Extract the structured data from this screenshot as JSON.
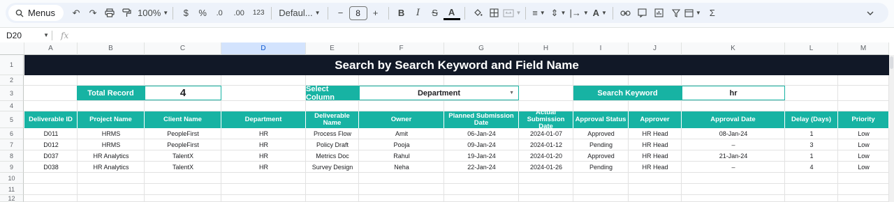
{
  "toolbar": {
    "menus_label": "Menus",
    "zoom": "100%",
    "currency": "$",
    "percent": "%",
    "dec_decrease": ".0",
    "dec_increase": ".00",
    "number_format": "123",
    "font": "Defaul...",
    "font_size": "8",
    "minus": "−",
    "plus": "+",
    "bold": "B",
    "italic": "I",
    "sum": "Σ"
  },
  "formula_bar": {
    "cell_ref": "D20",
    "fx": "fx",
    "value": ""
  },
  "columns": [
    "A",
    "B",
    "C",
    "D",
    "E",
    "F",
    "G",
    "H",
    "I",
    "J",
    "K",
    "L",
    "M"
  ],
  "rows": [
    "1",
    "2",
    "3",
    "4",
    "5",
    "6",
    "7",
    "8",
    "9",
    "10",
    "11",
    "12"
  ],
  "sheet": {
    "title": "Search by Search Keyword and Field Name",
    "total_record_label": "Total Record",
    "total_record_value": "4",
    "select_column_label": "Select Column",
    "select_column_value": "Department",
    "search_keyword_label": "Search Keyword",
    "search_keyword_value": "hr"
  },
  "table": {
    "headers": [
      "Deliverable ID",
      "Project Name",
      "Client Name",
      "Department",
      "Deliverable Name",
      "Owner",
      "Planned Submission Date",
      "Actual Submission Date",
      "Approval Status",
      "Approver",
      "Approval Date",
      "Delay (Days)",
      "Priority"
    ],
    "rows": [
      [
        "D011",
        "HRMS",
        "PeopleFirst",
        "HR",
        "Process Flow",
        "Amit",
        "06-Jan-24",
        "2024-01-07",
        "Approved",
        "HR Head",
        "08-Jan-24",
        "1",
        "Low"
      ],
      [
        "D012",
        "HRMS",
        "PeopleFirst",
        "HR",
        "Policy Draft",
        "Pooja",
        "09-Jan-24",
        "2024-01-12",
        "Pending",
        "HR Head",
        "–",
        "3",
        "Low"
      ],
      [
        "D037",
        "HR Analytics",
        "TalentX",
        "HR",
        "Metrics Doc",
        "Rahul",
        "19-Jan-24",
        "2024-01-20",
        "Approved",
        "HR Head",
        "21-Jan-24",
        "1",
        "Low"
      ],
      [
        "D038",
        "HR Analytics",
        "TalentX",
        "HR",
        "Survey Design",
        "Neha",
        "22-Jan-24",
        "2024-01-26",
        "Pending",
        "HR Head",
        "–",
        "4",
        "Low"
      ]
    ]
  }
}
